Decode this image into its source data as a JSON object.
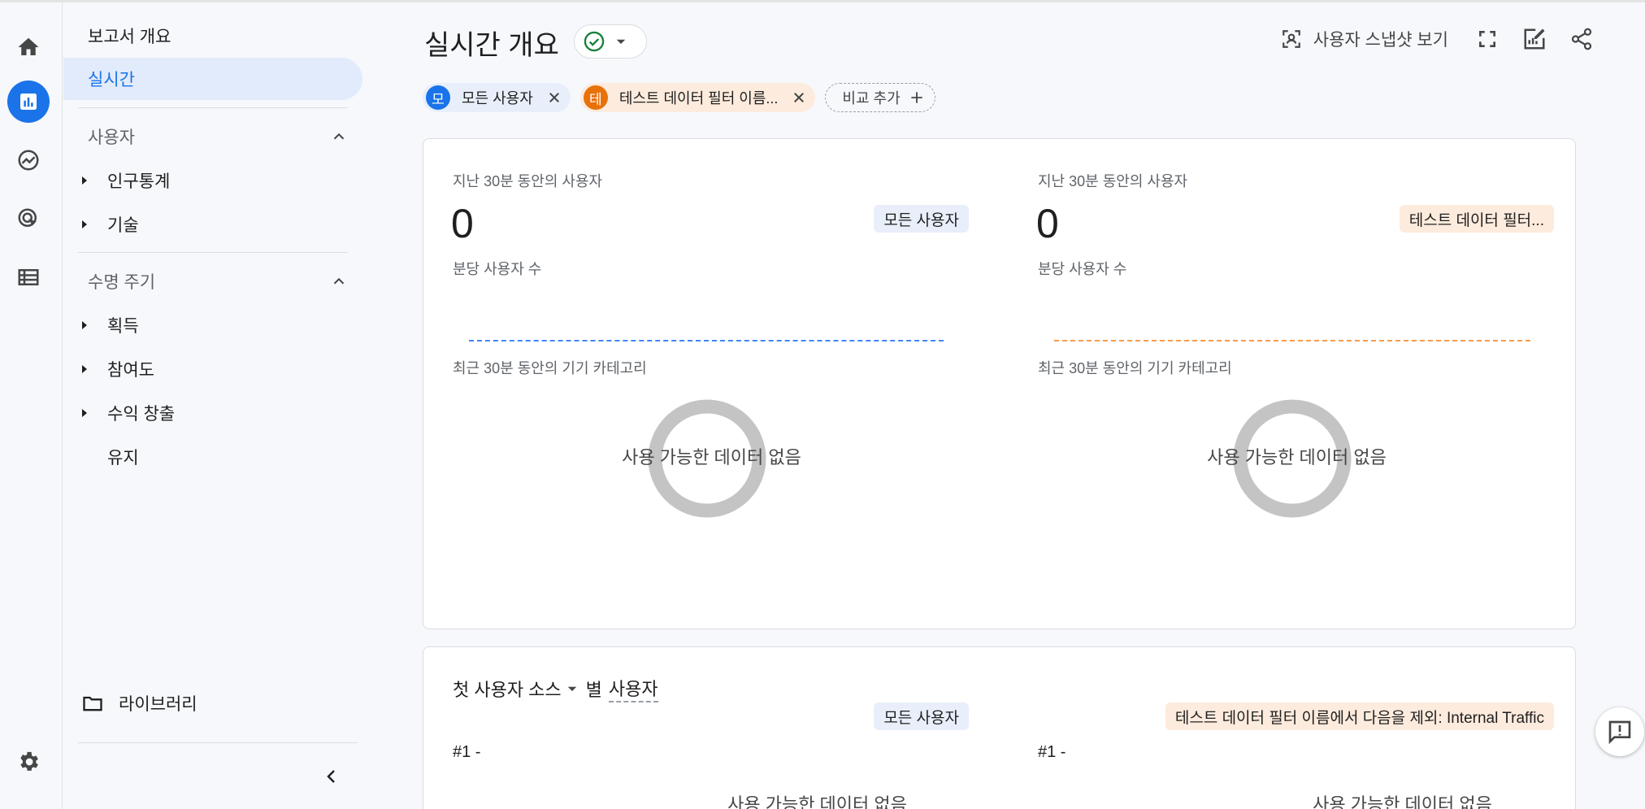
{
  "nav": {
    "report_overview": "보고서 개요",
    "realtime": "실시간",
    "section_users": "사용자",
    "users_items": [
      "인구통계",
      "기술"
    ],
    "section_lifecycle": "수명 주기",
    "lifecycle_items": [
      "획득",
      "참여도",
      "수익 창출"
    ],
    "retention": "유지",
    "library": "라이브러리"
  },
  "header": {
    "title": "실시간 개요",
    "snapshot_label": "사용자 스냅샷 보기"
  },
  "chips": {
    "all_users": {
      "avatar": "모",
      "label": "모든 사용자"
    },
    "test_filter": {
      "avatar": "테",
      "label": "테스트 데이터 필터 이름..."
    },
    "add_compare": "비교 추가"
  },
  "card1": {
    "left": {
      "users_30min_label": "지난 30분 동안의 사용자",
      "users_count": "0",
      "segment": "모든 사용자",
      "per_minute_label": "분당 사용자 수",
      "device_label": "최근 30분 동안의 기기 카테고리",
      "no_data": "사용 가능한 데이터 없음"
    },
    "right": {
      "users_30min_label": "지난 30분 동안의 사용자",
      "users_count": "0",
      "segment": "테스트 데이터 필터...",
      "per_minute_label": "분당 사용자 수",
      "device_label": "최근 30분 동안의 기기 카테고리",
      "no_data": "사용 가능한 데이터 없음"
    }
  },
  "card2": {
    "title_dim": "첫 사용자 소스",
    "title_by": "별",
    "title_metric": "사용자",
    "left": {
      "segment": "모든 사용자",
      "rank": "#1  -",
      "no_data": "사용 가능한 데이터 없음"
    },
    "right": {
      "segment": "테스트 데이터 필터 이름에서 다음을 제외: Internal Traffic",
      "rank": "#1  -",
      "no_data": "사용 가능한 데이터 없음"
    }
  },
  "colors": {
    "accent_blue": "#1a73e8",
    "compare_orange": "#e8710a",
    "spark_blue": "#4285f4",
    "spark_orange": "#fa9b4b",
    "donut_gray": "#c4c4c4"
  }
}
